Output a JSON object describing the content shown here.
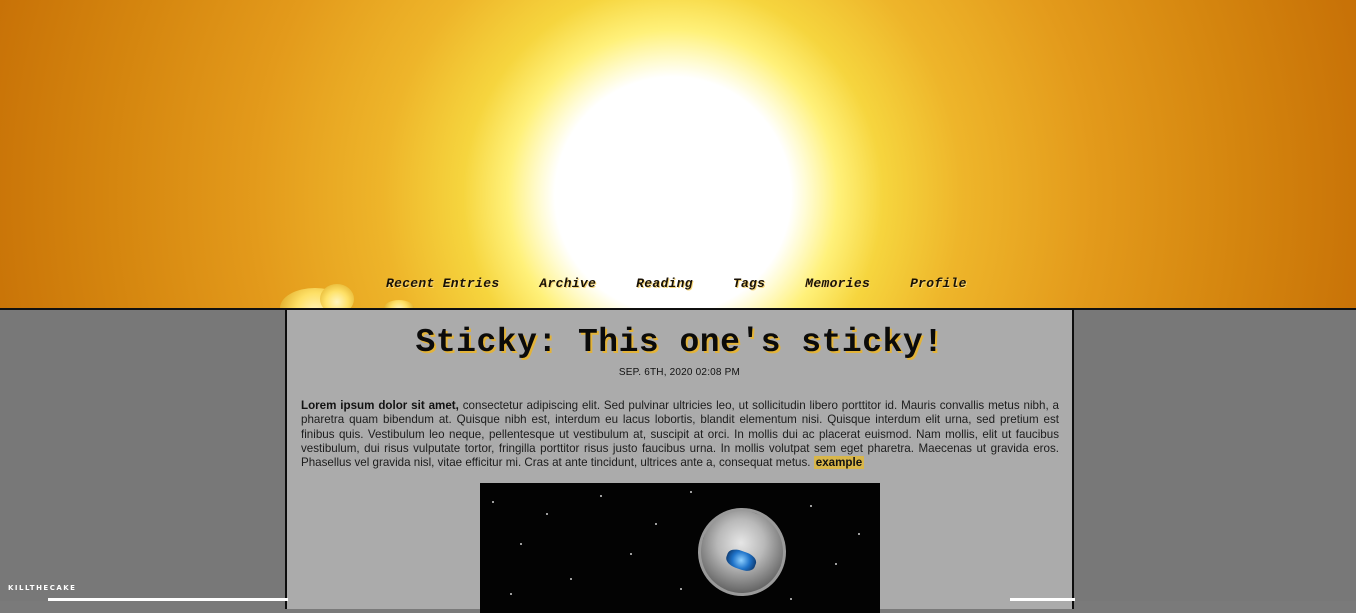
{
  "nav": {
    "items": [
      {
        "label": "Recent Entries"
      },
      {
        "label": "Archive"
      },
      {
        "label": "Reading"
      },
      {
        "label": "Tags"
      },
      {
        "label": "Memories"
      },
      {
        "label": "Profile"
      }
    ]
  },
  "entry": {
    "title": "Sticky: This one's sticky!",
    "date": "SEP. 6TH, 2020 02:08 PM",
    "body_bold": "Lorem ipsum dolor sit amet,",
    "body_text": " consectetur adipiscing elit. Sed pulvinar ultricies leo, ut sollicitudin libero porttitor id. Mauris convallis metus nibh, a pharetra quam bibendum at. Quisque nibh est, interdum eu lacus lobortis, blandit elementum nisi. Quisque interdum elit urna, sed pretium est finibus quis. Vestibulum leo neque, pellentesque ut vestibulum at, suscipit at orci. In mollis dui ac placerat euismod. Nam mollis, elit ut faucibus vestibulum, dui risus vulputate tortor, fringilla porttitor risus justo faucibus urna. In mollis volutpat sem eget pharetra. Maecenas ut gravida eros. Phasellus vel gravida nisl, vitae efficitur mi. Cras at ante tincidunt, ultrices ante a, consequat metus. ",
    "tag_link": "example"
  },
  "footer": {
    "label": "KILLTHECAKE"
  },
  "colors": {
    "accent": "#d8b64a",
    "content_bg": "#ababab",
    "side_bg": "#787878",
    "header_sun": "#ffffff"
  }
}
